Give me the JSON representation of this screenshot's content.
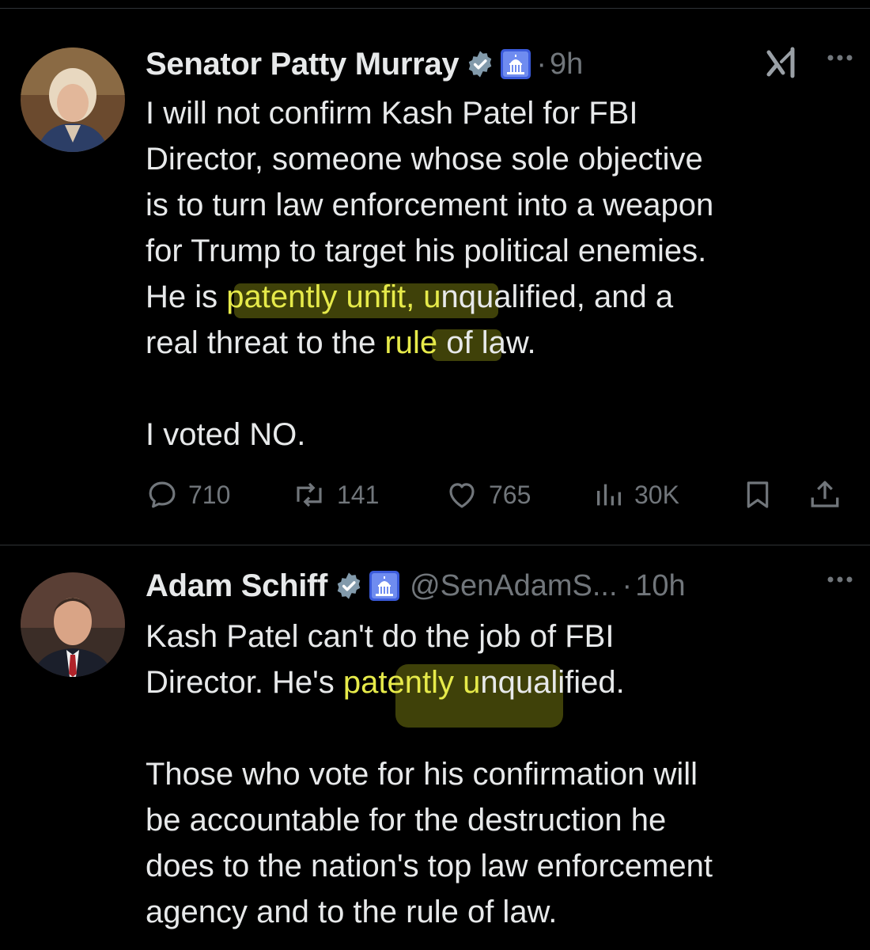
{
  "tweets": [
    {
      "author": "Senator Patty Murray",
      "time": "9h",
      "dot": "·",
      "body": {
        "l1": "I will not confirm Kash Patel for FBI",
        "l2": "Director, someone whose sole objective",
        "l3": "is to turn law enforcement into a weapon",
        "l4": "for Trump to target his political enemies.",
        "l5_a": "He is ",
        "l5_hl": "patently unfit, u",
        "l5_b": "nqualified, and a",
        "l6_a": "real threat to the ",
        "l6_hl": "rule",
        "l6_b": " of law.",
        "l7": "I voted NO."
      },
      "stats": {
        "replies": "710",
        "reposts": "141",
        "likes": "765",
        "views": "30K"
      }
    },
    {
      "author": "Adam Schiff",
      "handle": "@SenAdamS...",
      "dot": "·",
      "time": "10h",
      "body": {
        "l1": "Kash Patel can't do the job of FBI",
        "l2_a": "Director. He's ",
        "l2_hl": "patently u",
        "l2_b": "nqualified.",
        "l3": "Those who vote for his confirmation will",
        "l4": "be accountable for the destruction he",
        "l5": "does to the nation's top law enforcement",
        "l6": "agency and to the rule of law."
      }
    }
  ],
  "icons": {
    "verified": "verified-badge-icon",
    "government": "capitol-government-icon",
    "grok": "grok-icon",
    "more": "more-dots-icon",
    "reply": "reply-icon",
    "repost": "repost-icon",
    "like": "heart-icon",
    "views": "views-chart-icon",
    "bookmark": "bookmark-icon",
    "share": "share-icon"
  },
  "colors": {
    "background": "#000000",
    "text": "#e7e9ea",
    "muted": "#71767b",
    "highlight": "#e6ea4a",
    "verified": "#829aab",
    "gov_badge": "#3b5bdb"
  }
}
